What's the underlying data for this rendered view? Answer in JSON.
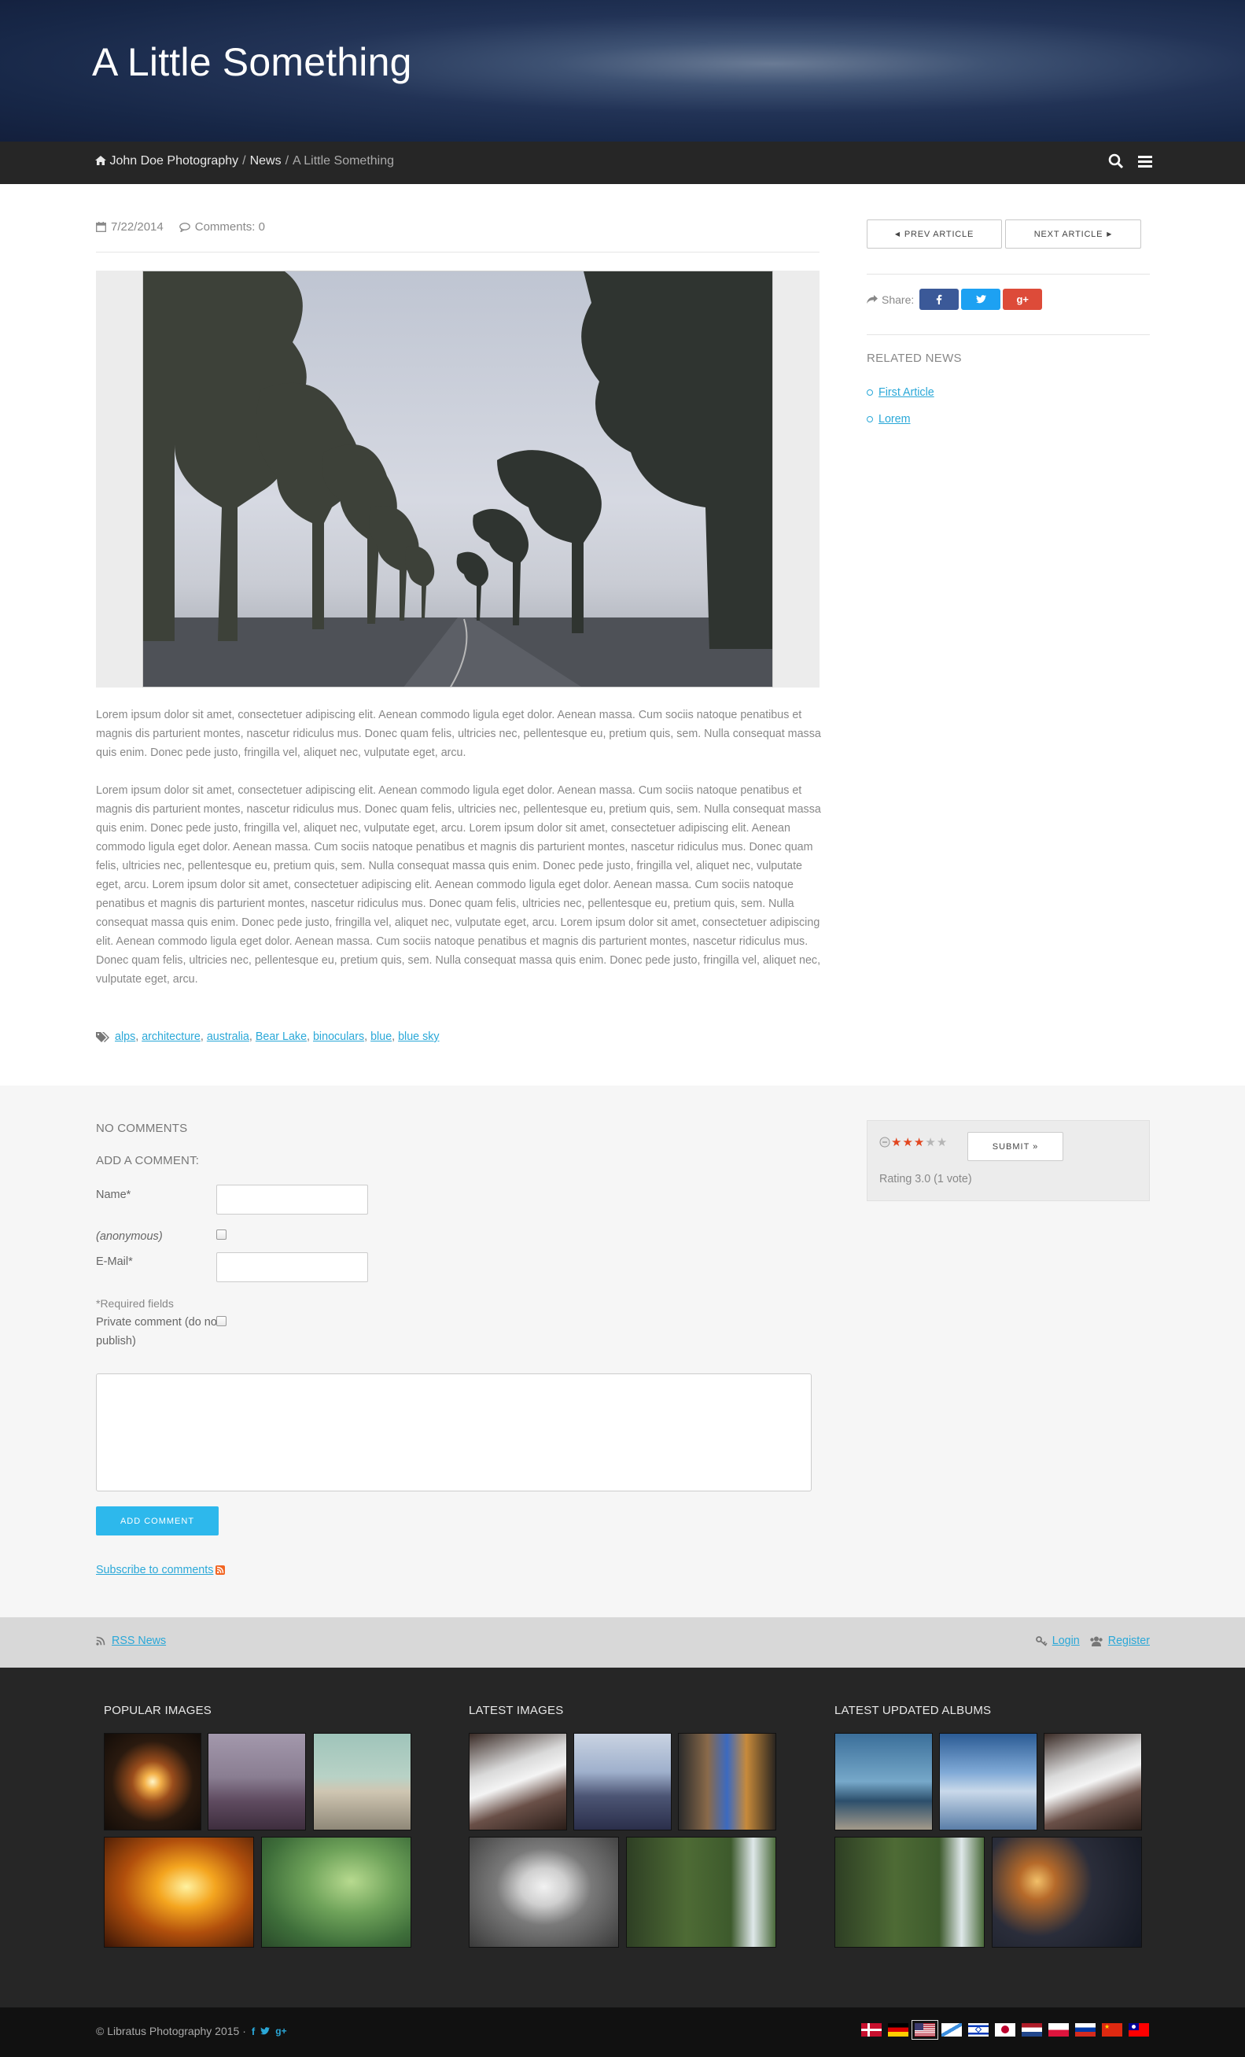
{
  "header": {
    "title": "A Little Something"
  },
  "breadcrumb": {
    "home": "John Doe Photography",
    "sep1": "/",
    "section": "News",
    "sep2": "/",
    "current": "A Little Something"
  },
  "article": {
    "date": "7/22/2014",
    "comments": "Comments: 0",
    "paragraph1": "Lorem ipsum dolor sit amet, consectetuer adipiscing elit. Aenean commodo ligula eget dolor. Aenean massa. Cum sociis natoque penatibus et magnis dis parturient montes, nascetur ridiculus mus. Donec quam felis, ultricies nec, pellentesque eu, pretium quis, sem. Nulla consequat massa quis enim. Donec pede justo, fringilla vel, aliquet nec, vulputate eget, arcu.",
    "paragraph2": "Lorem ipsum dolor sit amet, consectetuer adipiscing elit. Aenean commodo ligula eget dolor. Aenean massa. Cum sociis natoque penatibus et magnis dis parturient montes, nascetur ridiculus mus. Donec quam felis, ultricies nec, pellentesque eu, pretium quis, sem. Nulla consequat massa quis enim. Donec pede justo, fringilla vel, aliquet nec, vulputate eget, arcu. Lorem ipsum dolor sit amet, consectetuer adipiscing elit. Aenean commodo ligula eget dolor. Aenean massa. Cum sociis natoque penatibus et magnis dis parturient montes, nascetur ridiculus mus. Donec quam felis, ultricies nec, pellentesque eu, pretium quis, sem. Nulla consequat massa quis enim. Donec pede justo, fringilla vel, aliquet nec, vulputate eget, arcu. Lorem ipsum dolor sit amet, consectetuer adipiscing elit. Aenean commodo ligula eget dolor. Aenean massa. Cum sociis natoque penatibus et magnis dis parturient montes, nascetur ridiculus mus. Donec quam felis, ultricies nec, pellentesque eu, pretium quis, sem. Nulla consequat massa quis enim. Donec pede justo, fringilla vel, aliquet nec, vulputate eget, arcu. Lorem ipsum dolor sit amet, consectetuer adipiscing elit. Aenean commodo ligula eget dolor. Aenean massa. Cum sociis natoque penatibus et magnis dis parturient montes, nascetur ridiculus mus. Donec quam felis, ultricies nec, pellentesque eu, pretium quis, sem. Nulla consequat massa quis enim. Donec pede justo, fringilla vel, aliquet nec, vulputate eget, arcu.",
    "tags": [
      "alps",
      "architecture",
      "australia",
      "Bear Lake",
      "binoculars",
      "blue",
      "blue sky"
    ]
  },
  "sidebar": {
    "prev": "PREV ARTICLE",
    "next": "NEXT ARTICLE",
    "share_label": "Share:",
    "related_title": "RELATED NEWS",
    "related": [
      "First Article",
      "Lorem"
    ]
  },
  "comments": {
    "no_comments": "NO COMMENTS",
    "add_comment": "ADD A COMMENT:",
    "name_label": "Name*",
    "anonymous_label": "anonymous",
    "email_label": "E-Mail*",
    "required": "*Required fields",
    "private_label": "Private comment (do not publish)",
    "add_button": "ADD COMMENT",
    "subscribe": "Subscribe to comments"
  },
  "rating": {
    "value": 3,
    "max": 5,
    "submit": "SUBMIT »",
    "text": "Rating 3.0 (1 vote)"
  },
  "links": {
    "rss": "RSS News",
    "login": "Login",
    "register": "Register"
  },
  "footer": {
    "popular": "POPULAR IMAGES",
    "latest": "LATEST IMAGES",
    "albums": "LATEST UPDATED ALBUMS",
    "copyright": "© Libratus Photography 2015 ·"
  },
  "languages": [
    "da",
    "de",
    "en-us",
    "gl",
    "he",
    "ja",
    "nl",
    "pl",
    "ru",
    "zh-cn",
    "zh-tw"
  ],
  "colors": {
    "accent": "#2aa8d8",
    "button": "#2db8ec",
    "facebook": "#3b5998",
    "twitter": "#1da1f2",
    "google": "#dd4b39"
  }
}
